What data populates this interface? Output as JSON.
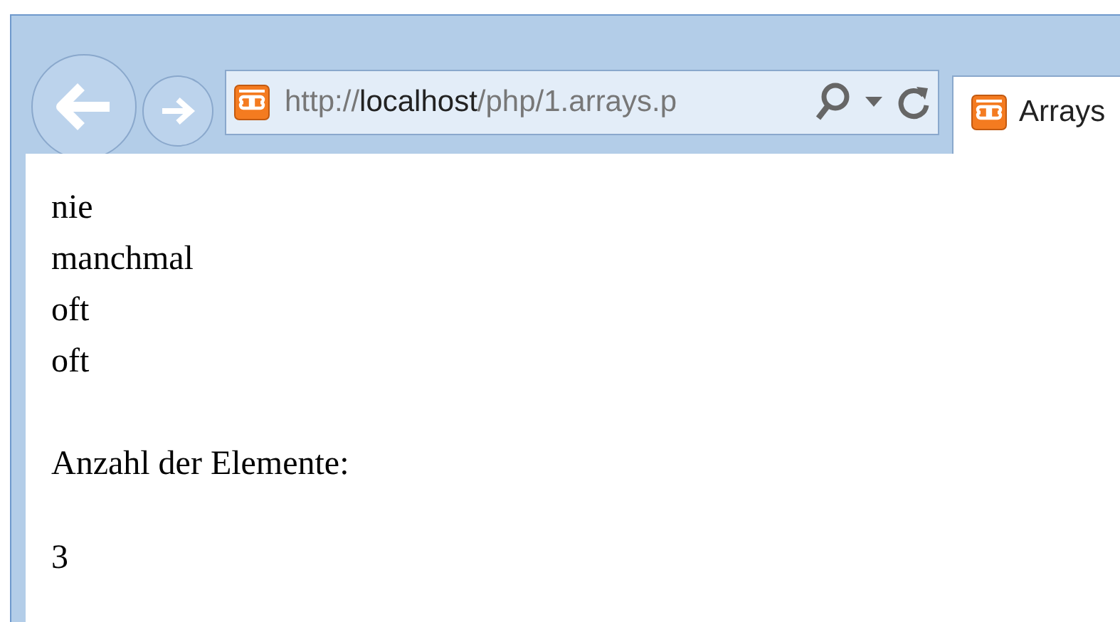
{
  "address_bar": {
    "url_scheme": "http://",
    "url_host": "localhost",
    "url_path": "/php/1.arrays.p"
  },
  "tabs": [
    {
      "label": "Arrays",
      "selected": true
    }
  ],
  "content": {
    "lines": [
      "nie",
      "manchmal",
      "oft",
      "oft"
    ],
    "heading": "Anzahl der Elemente:",
    "count": "3"
  }
}
